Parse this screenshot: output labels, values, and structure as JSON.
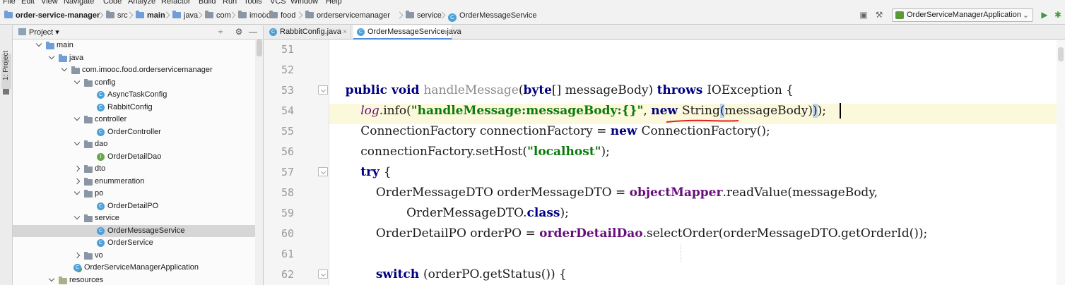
{
  "menu": [
    "File",
    "Edit",
    "View",
    "Navigate",
    "Code",
    "Analyze",
    "Refactor",
    "Build",
    "Run",
    "Tools",
    "VCS",
    "Window",
    "Help"
  ],
  "breadcrumb": [
    "order-service-manager",
    "src",
    "main",
    "java",
    "com",
    "imooc",
    "food",
    "orderservicemanager",
    "service",
    "OrderMessageService"
  ],
  "run_config": {
    "label": "OrderServiceManagerApplication"
  },
  "project_panel": {
    "title": "Project"
  },
  "side_tab": {
    "label": "1: Project"
  },
  "tree": [
    {
      "label": "main",
      "level": 0,
      "expanded": true,
      "icon": "folder-blue"
    },
    {
      "label": "java",
      "level": 1,
      "expanded": true,
      "icon": "folder-blue"
    },
    {
      "label": "com.imooc.food.orderservicemanager",
      "level": 2,
      "expanded": true,
      "icon": "package"
    },
    {
      "label": "config",
      "level": 3,
      "expanded": true,
      "icon": "package"
    },
    {
      "label": "AsyncTaskConfig",
      "level": 4,
      "icon": "class"
    },
    {
      "label": "RabbitConfig",
      "level": 4,
      "icon": "class"
    },
    {
      "label": "controller",
      "level": 3,
      "expanded": true,
      "icon": "package"
    },
    {
      "label": "OrderController",
      "level": 4,
      "icon": "class"
    },
    {
      "label": "dao",
      "level": 3,
      "expanded": true,
      "icon": "package"
    },
    {
      "label": "OrderDetailDao",
      "level": 4,
      "icon": "interface"
    },
    {
      "label": "dto",
      "level": 3,
      "expanded": false,
      "icon": "package"
    },
    {
      "label": "enummeration",
      "level": 3,
      "expanded": false,
      "icon": "package"
    },
    {
      "label": "po",
      "level": 3,
      "expanded": true,
      "icon": "package"
    },
    {
      "label": "OrderDetailPO",
      "level": 4,
      "icon": "class"
    },
    {
      "label": "service",
      "level": 3,
      "expanded": true,
      "icon": "package"
    },
    {
      "label": "OrderMessageService",
      "level": 4,
      "icon": "class",
      "selected": true
    },
    {
      "label": "OrderService",
      "level": 4,
      "icon": "class"
    },
    {
      "label": "vo",
      "level": 3,
      "expanded": false,
      "icon": "package"
    },
    {
      "label": "OrderServiceManagerApplication",
      "level": 3,
      "icon": "app"
    },
    {
      "label": "resources",
      "level": 1,
      "expanded": true,
      "icon": "folder-res"
    }
  ],
  "tabs": [
    {
      "label": "RabbitConfig.java",
      "active": false
    },
    {
      "label": "OrderMessageService.java",
      "active": true
    }
  ],
  "editor": {
    "current_line": 54,
    "lines": [
      {
        "n": 51,
        "tokens": []
      },
      {
        "n": 52,
        "tokens": []
      },
      {
        "n": 53,
        "fold": true,
        "tokens": [
          [
            "    ",
            ""
          ],
          [
            "public void ",
            "kw"
          ],
          [
            "handleMessage",
            "meth"
          ],
          [
            "(",
            ""
          ],
          [
            "byte",
            "kw"
          ],
          [
            "[] messageBody) ",
            ""
          ],
          [
            "throws ",
            "kw"
          ],
          [
            "IOException {",
            ""
          ]
        ]
      },
      {
        "n": 54,
        "tokens": [
          [
            "        ",
            ""
          ],
          [
            "log",
            "static"
          ],
          [
            ".info(",
            ""
          ],
          [
            "\"handleMessage:messageBody:{}\"",
            "str"
          ],
          [
            ", ",
            ""
          ],
          [
            "new ",
            "kw"
          ],
          [
            "String",
            ""
          ],
          [
            "(",
            "hl-paren"
          ],
          [
            "messageBody)",
            ""
          ],
          [
            ")",
            "hl-paren"
          ],
          [
            ");",
            ""
          ]
        ]
      },
      {
        "n": 55,
        "tokens": [
          [
            "        ConnectionFactory connectionFactory = ",
            ""
          ],
          [
            "new ",
            "kw"
          ],
          [
            "ConnectionFactory();",
            ""
          ]
        ]
      },
      {
        "n": 56,
        "tokens": [
          [
            "        connectionFactory.setHost(",
            ""
          ],
          [
            "\"localhost\"",
            "str"
          ],
          [
            ");",
            ""
          ]
        ]
      },
      {
        "n": 57,
        "fold": true,
        "tokens": [
          [
            "        ",
            ""
          ],
          [
            "try ",
            "kw"
          ],
          [
            "{",
            ""
          ]
        ]
      },
      {
        "n": 58,
        "tokens": [
          [
            "            OrderMessageDTO orderMessageDTO = ",
            ""
          ],
          [
            "objectMapper",
            "field"
          ],
          [
            ".readValue(messageBody,",
            ""
          ]
        ]
      },
      {
        "n": 59,
        "tokens": [
          [
            "                    OrderMessageDTO.",
            ""
          ],
          [
            "class",
            "kw"
          ],
          [
            ");",
            ""
          ]
        ]
      },
      {
        "n": 60,
        "tokens": [
          [
            "            OrderDetailPO orderPO = ",
            ""
          ],
          [
            "orderDetailDao",
            "field"
          ],
          [
            ".selectOrder(orderMessageDTO.getOrderId());",
            ""
          ]
        ]
      },
      {
        "n": 61,
        "tokens": []
      },
      {
        "n": 62,
        "fold": true,
        "tokens": [
          [
            "            ",
            ""
          ],
          [
            "switch ",
            "kw"
          ],
          [
            "(orderPO.getStatus()) {",
            ""
          ]
        ]
      }
    ]
  }
}
